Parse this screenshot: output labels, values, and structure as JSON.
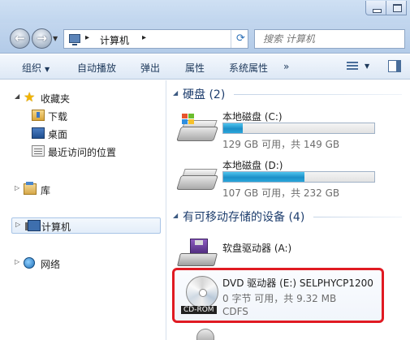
{
  "window": {
    "controls": {
      "minimize_icon": "minimize-icon",
      "maximize_icon": "maximize-icon"
    }
  },
  "address_bar": {
    "crumb_root_icon": "computer-icon",
    "crumb": "计算机",
    "search_placeholder": "搜索 计算机"
  },
  "toolbar": {
    "organize": "组织",
    "autoplay": "自动播放",
    "eject": "弹出",
    "properties": "属性",
    "system_properties": "系统属性",
    "more": "»"
  },
  "navpane": {
    "favorites": {
      "label": "收藏夹",
      "items": [
        {
          "label": "下载"
        },
        {
          "label": "桌面"
        },
        {
          "label": "最近访问的位置"
        }
      ]
    },
    "libraries": "库",
    "computer": "计算机",
    "network": "网络"
  },
  "content": {
    "hard_disks": {
      "title": "硬盘 (2)",
      "drives": [
        {
          "name": "本地磁盘 (C:)",
          "usage": "129 GB 可用，共 149 GB",
          "used_fraction": 0.13
        },
        {
          "name": "本地磁盘 (D:)",
          "usage": "107 GB 可用，共 232 GB",
          "used_fraction": 0.54
        }
      ]
    },
    "removable": {
      "title": "有可移动存储的设备 (4)",
      "floppy": {
        "name": "软盘驱动器 (A:)"
      },
      "dvd": {
        "name": "DVD 驱动器 (E:) SELPHYCP1200",
        "usage": "0 字节 可用，共 9.32 MB",
        "fs": "CDFS",
        "badge": "CD-ROM"
      }
    }
  },
  "colors": {
    "accent": "#1e3e6e",
    "highlight_border": "#e01a22",
    "bar_fill": "#1d8fc8"
  }
}
